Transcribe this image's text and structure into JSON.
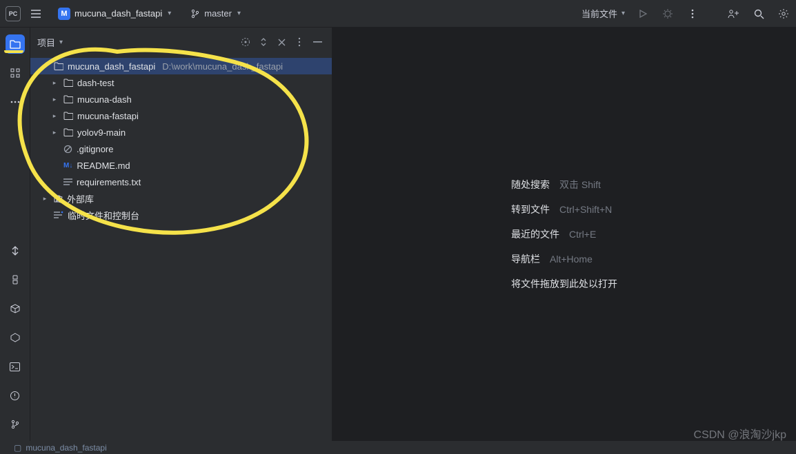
{
  "titlebar": {
    "app_logo": "PC",
    "proj_badge": "M",
    "project_name": "mucuna_dash_fastapi",
    "branch_name": "master",
    "run_config": "当前文件"
  },
  "sidebar": {
    "title": "项目",
    "root": {
      "name": "mucuna_dash_fastapi",
      "path": "D:\\work\\mucuna_dash_fastapi"
    },
    "folders": [
      {
        "name": "dash-test"
      },
      {
        "name": "mucuna-dash"
      },
      {
        "name": "mucuna-fastapi"
      },
      {
        "name": "yolov9-main"
      }
    ],
    "files": [
      {
        "name": ".gitignore",
        "icon": "ignore"
      },
      {
        "name": "README.md",
        "icon": "md"
      },
      {
        "name": "requirements.txt",
        "icon": "txt"
      }
    ],
    "extra": [
      {
        "name": "外部库",
        "icon": "lib"
      },
      {
        "name": "临时文件和控制台",
        "icon": "scratch"
      }
    ]
  },
  "editor_hints": [
    {
      "label": "随处搜索",
      "key": "双击 Shift"
    },
    {
      "label": "转到文件",
      "key": "Ctrl+Shift+N"
    },
    {
      "label": "最近的文件",
      "key": "Ctrl+E"
    },
    {
      "label": "导航栏",
      "key": "Alt+Home"
    },
    {
      "label": "将文件拖放到此处以打开",
      "key": ""
    }
  ],
  "status_bar": "mucuna_dash_fastapi",
  "watermark": "CSDN @浪淘沙jkp"
}
